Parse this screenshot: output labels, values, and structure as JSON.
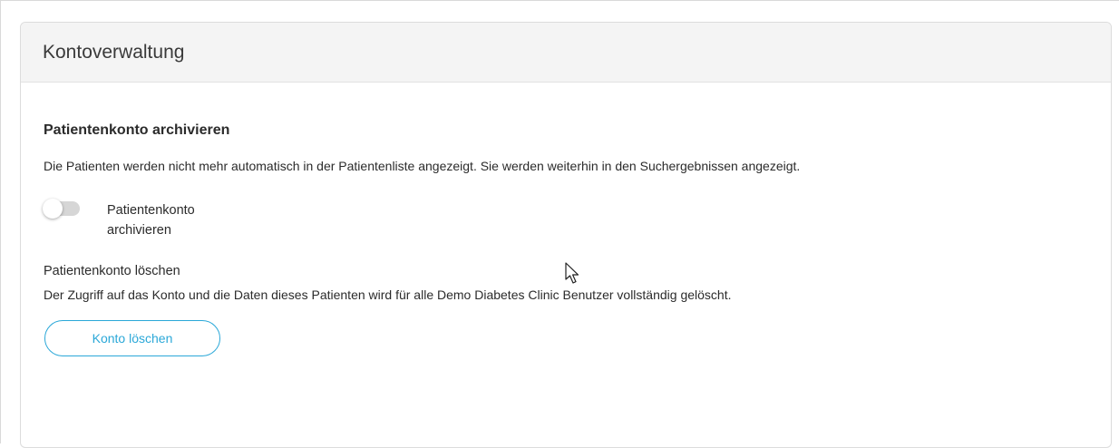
{
  "card": {
    "title": "Kontoverwaltung"
  },
  "archive": {
    "title": "Patientenkonto archivieren",
    "description": "Die Patienten werden nicht mehr automatisch in der Patientenliste angezeigt. Sie werden weiterhin in den Suchergebnissen angezeigt.",
    "toggle_label": "Patientenkonto archivieren",
    "toggle_on": false
  },
  "delete": {
    "title": "Patientenkonto löschen",
    "description": "Der Zugriff auf das Konto und die Daten dieses Patienten wird für alle Demo Diabetes Clinic Benutzer vollständig gelöscht.",
    "button_label": "Konto löschen"
  },
  "colors": {
    "accent": "#2ba8d8",
    "header_bg": "#f4f4f4",
    "toggle_off": "#d6d6d6"
  },
  "icons": {
    "cursor": "mouse-pointer-icon"
  }
}
